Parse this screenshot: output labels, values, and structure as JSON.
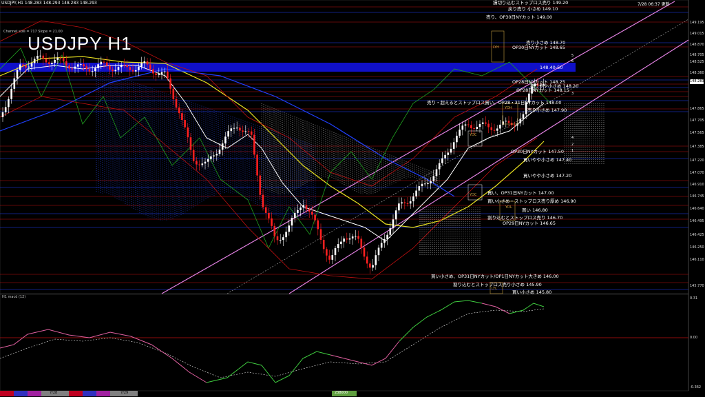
{
  "header": {
    "symbol_info": "USDJPY,H1  148.283 148.293 148.283 148.293",
    "title": "USDJPY H1",
    "channel_info": "Channel size = 717  Slope = 21.00",
    "datetime": "7/28 06:37 更新"
  },
  "price_axis": [
    "149.195",
    "149.015",
    "148.870",
    "148.705",
    "148.525",
    "148.360",
    "148.283",
    "147.865",
    "147.705",
    "147.565",
    "147.385",
    "147.220",
    "147.070",
    "146.910",
    "146.745",
    "146.640",
    "146.495",
    "146.425",
    "146.250",
    "146.110",
    "145.770"
  ],
  "current_price": "148.283",
  "annotations": [
    {
      "text": "損切り込むストップロス売り 149.20",
      "color": "#ffffff"
    },
    {
      "text": "戻り売り 小さめ 149.10",
      "color": "#ffffff"
    },
    {
      "text": "売り、OP30日NYカット 149.00",
      "color": "#ffffff"
    },
    {
      "text": "売り小さめ 148.70",
      "color": "#ffffff"
    },
    {
      "text": "OP30日NYカット 148.65",
      "color": "#ffffff"
    },
    {
      "text": "148.40-50",
      "color": "#ffffff"
    },
    {
      "text": "OP28日NYカット 148.25",
      "color": "#ffffff"
    },
    {
      "text": "売りやや小さめ 148.20",
      "color": "#ffffff"
    },
    {
      "text": "OP28日NYカット 148.15",
      "color": "#ffffff"
    },
    {
      "text": "売り・超えるとストップロス買い、OP28・31日NYカット 148.00",
      "color": "#ffffff"
    },
    {
      "text": "売り小さめ 147.90",
      "color": "#ffffff"
    },
    {
      "text": "OP30日NYカット 147.50",
      "color": "#ffffff"
    },
    {
      "text": "買いやや小さめ 147.40",
      "color": "#ffffff"
    },
    {
      "text": "買いやや小さめ 147.20",
      "color": "#ffffff"
    },
    {
      "text": "買い、OP31日NYカット 147.00",
      "color": "#ffffff"
    },
    {
      "text": "買い小さめ・ストップロス売り厚め 146.90",
      "color": "#ffffff"
    },
    {
      "text": "買い 146.80",
      "color": "#ffffff"
    },
    {
      "text": "割り込むとストップロス売り 146.70",
      "color": "#ffffff"
    },
    {
      "text": "OP29日NYカット 146.65",
      "color": "#ffffff"
    },
    {
      "text": "買い小さめ、OP31日NYカット/OP1日NYカット大きめ 146.00",
      "color": "#ffffff"
    },
    {
      "text": "割り込むとストップロス売り小さめ 145.90",
      "color": "#ffffff"
    },
    {
      "text": "買い小さめ 145.80",
      "color": "#ffffff"
    }
  ],
  "markers": [
    "LYH",
    "YDH",
    "YDC",
    "YDC",
    "YDL",
    "LYL",
    "5",
    "6",
    "3",
    "4",
    "2",
    "1"
  ],
  "macd": {
    "label": "H1  macd (12)",
    "axis_top": "0.31",
    "axis_zero": "0.00",
    "axis_bottom": "-0.362"
  },
  "bottom_bar": {
    "dates": [
      "7/28",
      "7/29"
    ],
    "right_text": "238000"
  },
  "colors": {
    "background": "#000000",
    "resistance_band": "#1010c8",
    "channel": "#e080e0",
    "ema_fast": "#ffffff",
    "ema_slow": "#e8e020",
    "macd_line": "#40d040",
    "macd_signal": "#e060a0",
    "bull_candle": "#ffffff",
    "bear_candle": "#ff2020"
  }
}
